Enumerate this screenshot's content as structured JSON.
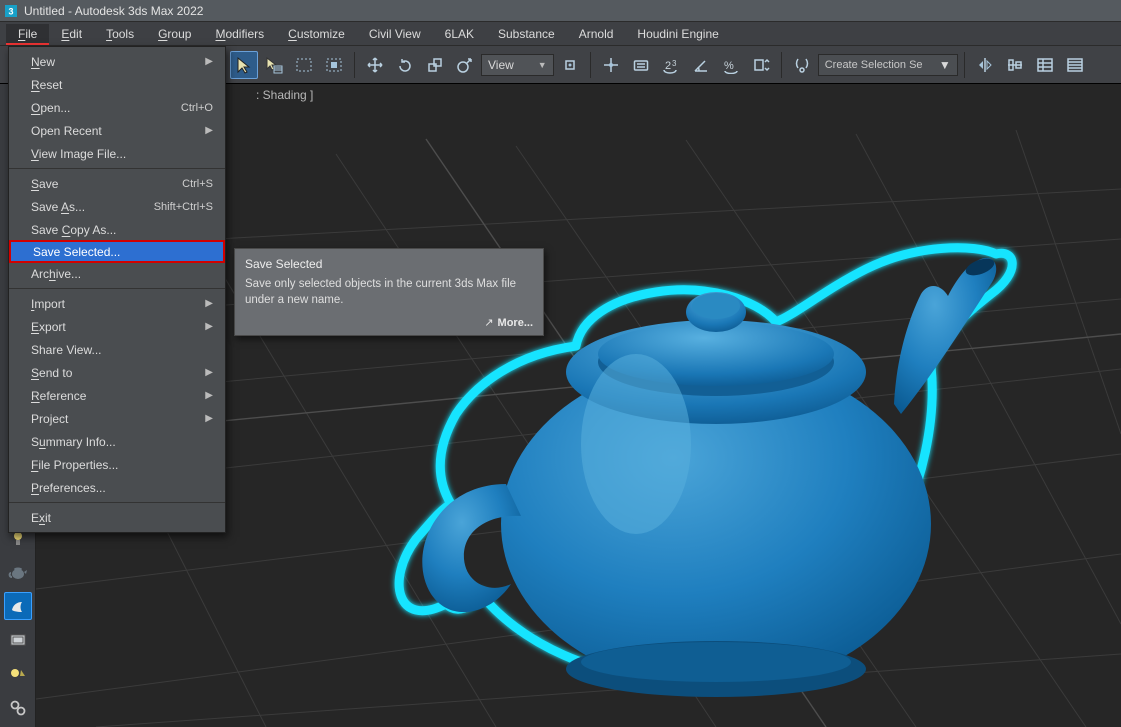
{
  "window": {
    "title": "Untitled - Autodesk 3ds Max 2022"
  },
  "menubar": {
    "items": [
      {
        "label": "File",
        "u": "F"
      },
      {
        "label": "Edit",
        "u": "E"
      },
      {
        "label": "Tools",
        "u": "T"
      },
      {
        "label": "Group",
        "u": "G"
      },
      {
        "label": "Modifiers",
        "u": "M"
      },
      {
        "label": "Customize",
        "u": "C"
      },
      {
        "label": "Civil View",
        "u": ""
      },
      {
        "label": "6LAK",
        "u": ""
      },
      {
        "label": "Substance",
        "u": ""
      },
      {
        "label": "Arnold",
        "u": ""
      },
      {
        "label": "Houdini Engine",
        "u": ""
      }
    ]
  },
  "toolbar": {
    "view_select": "View",
    "selection_set_placeholder": "Create Selection Se"
  },
  "viewport": {
    "label": ": Shading ]"
  },
  "file_menu": {
    "items": [
      {
        "label": "New",
        "shortcut": "",
        "sub": true,
        "u": "N"
      },
      {
        "label": "Reset",
        "shortcut": "",
        "sub": false,
        "u": "R"
      },
      {
        "label": "Open...",
        "shortcut": "Ctrl+O",
        "sub": false,
        "u": "O"
      },
      {
        "label": "Open Recent",
        "shortcut": "",
        "sub": true,
        "u": ""
      },
      {
        "label": "View Image File...",
        "shortcut": "",
        "sub": false,
        "u": "V"
      },
      {
        "sep": true
      },
      {
        "label": "Save",
        "shortcut": "Ctrl+S",
        "sub": false,
        "u": "S"
      },
      {
        "label": "Save As...",
        "shortcut": "Shift+Ctrl+S",
        "sub": false,
        "u": "A"
      },
      {
        "label": "Save Copy As...",
        "shortcut": "",
        "sub": false,
        "u": "C"
      },
      {
        "label": "Save Selected...",
        "shortcut": "",
        "sub": false,
        "u": "",
        "highlight": true
      },
      {
        "label": "Archive...",
        "shortcut": "",
        "sub": false,
        "u": "h"
      },
      {
        "sep": true
      },
      {
        "label": "Import",
        "shortcut": "",
        "sub": true,
        "u": "I"
      },
      {
        "label": "Export",
        "shortcut": "",
        "sub": true,
        "u": "E"
      },
      {
        "label": "Share View...",
        "shortcut": "",
        "sub": false,
        "u": ""
      },
      {
        "label": "Send to",
        "shortcut": "",
        "sub": true,
        "u": "S"
      },
      {
        "label": "Reference",
        "shortcut": "",
        "sub": true,
        "u": "R"
      },
      {
        "label": "Project",
        "shortcut": "",
        "sub": true,
        "u": "j"
      },
      {
        "label": "Summary Info...",
        "shortcut": "",
        "sub": false,
        "u": "u"
      },
      {
        "label": "File Properties...",
        "shortcut": "",
        "sub": false,
        "u": "F"
      },
      {
        "label": "Preferences...",
        "shortcut": "",
        "sub": false,
        "u": "P"
      },
      {
        "sep": true
      },
      {
        "label": "Exit",
        "shortcut": "",
        "sub": false,
        "u": "x"
      }
    ]
  },
  "tooltip": {
    "title": "Save Selected",
    "body": "Save only selected objects in the current 3ds Max file under a new name.",
    "more": "More..."
  }
}
